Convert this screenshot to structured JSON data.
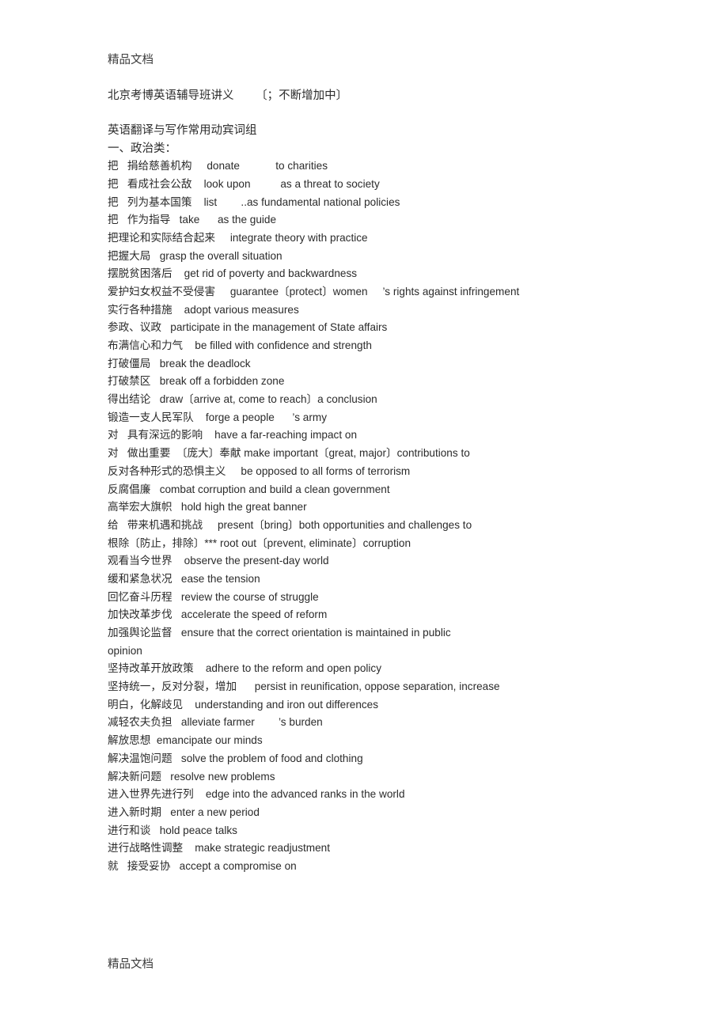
{
  "document": {
    "header_watermark": "精品文档",
    "footer_watermark": "精品文档",
    "title": "北京考博英语辅导班讲义      〔；不断增加中〕",
    "subtitle": "英语翻译与写作常用动宾词组",
    "section_heading": "一、政治类：",
    "entries": [
      "把   捐给慈善机构     donate            to charities",
      "把   看成社会公敌    look upon          as a threat to society",
      "把   列为基本国策    list        ..as fundamental national policies",
      "把   作为指导   take      as the guide",
      "把理论和实际结合起来     integrate theory with practice",
      "把握大局   grasp the overall situation",
      "摆脱贫困落后    get rid of poverty and backwardness",
      "爱护妇女权益不受侵害     guarantee〔protect〕women     ’s rights against infringement",
      "实行各种措施    adopt various measures",
      "参政、议政   participate in the management of State affairs",
      "布满信心和力气    be filled with confidence and strength",
      "打破僵局   break the deadlock",
      "打破禁区   break off a forbidden zone",
      "得出结论   draw〔arrive at, come to reach〕a conclusion",
      "锻造一支人民军队    forge a people      ’s army",
      "对   具有深远的影响    have a far-reaching impact on",
      "对   做出重要  〔庞大〕奉献 make important〔great, major〕contributions to",
      "反对各种形式的恐惧主义     be opposed to all forms of terrorism",
      "反腐倡廉   combat corruption and build a clean government",
      "高举宏大旗帜   hold high the great banner",
      "给   带来机遇和挑战     present〔bring〕both opportunities and challenges to",
      "根除〔防止，排除〕*** root out〔prevent, eliminate〕corruption",
      "观看当今世界    observe the present-day world",
      "缓和紧急状况   ease the tension",
      "回忆奋斗历程   review the course of struggle",
      "加快改革步伐   accelerate the speed of reform",
      "加强舆论监督   ensure that the correct orientation is maintained in public",
      "opinion",
      "坚持改革开放政策    adhere to the reform and open policy",
      "坚持统一，反对分裂，增加      persist in reunification, oppose separation, increase",
      "明白，化解歧见    understanding and iron out differences",
      "减轻农夫负担   alleviate farmer        ’s burden",
      "解放思想  emancipate our minds",
      "解决温饱问题   solve the problem of food and clothing",
      "解决新问题   resolve new problems",
      "进入世界先进行列    edge into the advanced ranks in the world",
      "进入新时期   enter a new period",
      "进行和谈   hold peace talks",
      "进行战略性调整    make strategic readjustment",
      "就   接受妥协   accept a compromise on"
    ]
  }
}
